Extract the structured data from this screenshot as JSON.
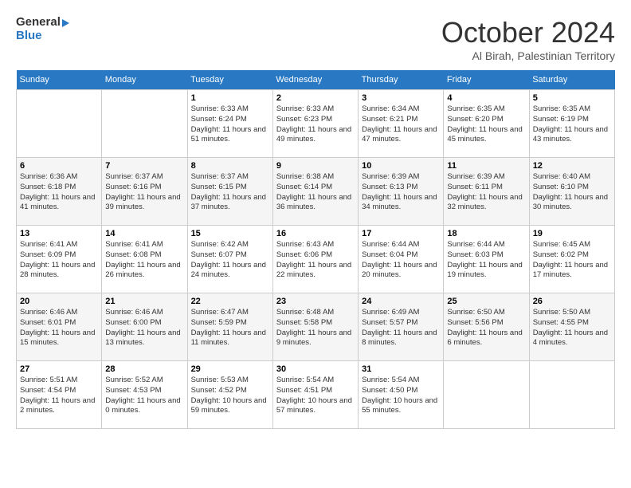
{
  "header": {
    "logo": {
      "general": "General",
      "blue": "Blue"
    },
    "title": "October 2024",
    "location": "Al Birah, Palestinian Territory"
  },
  "days": [
    "Sunday",
    "Monday",
    "Tuesday",
    "Wednesday",
    "Thursday",
    "Friday",
    "Saturday"
  ],
  "weeks": [
    [
      {
        "num": "",
        "text": ""
      },
      {
        "num": "",
        "text": ""
      },
      {
        "num": "1",
        "text": "Sunrise: 6:33 AM\nSunset: 6:24 PM\nDaylight: 11 hours and 51 minutes."
      },
      {
        "num": "2",
        "text": "Sunrise: 6:33 AM\nSunset: 6:23 PM\nDaylight: 11 hours and 49 minutes."
      },
      {
        "num": "3",
        "text": "Sunrise: 6:34 AM\nSunset: 6:21 PM\nDaylight: 11 hours and 47 minutes."
      },
      {
        "num": "4",
        "text": "Sunrise: 6:35 AM\nSunset: 6:20 PM\nDaylight: 11 hours and 45 minutes."
      },
      {
        "num": "5",
        "text": "Sunrise: 6:35 AM\nSunset: 6:19 PM\nDaylight: 11 hours and 43 minutes."
      }
    ],
    [
      {
        "num": "6",
        "text": "Sunrise: 6:36 AM\nSunset: 6:18 PM\nDaylight: 11 hours and 41 minutes."
      },
      {
        "num": "7",
        "text": "Sunrise: 6:37 AM\nSunset: 6:16 PM\nDaylight: 11 hours and 39 minutes."
      },
      {
        "num": "8",
        "text": "Sunrise: 6:37 AM\nSunset: 6:15 PM\nDaylight: 11 hours and 37 minutes."
      },
      {
        "num": "9",
        "text": "Sunrise: 6:38 AM\nSunset: 6:14 PM\nDaylight: 11 hours and 36 minutes."
      },
      {
        "num": "10",
        "text": "Sunrise: 6:39 AM\nSunset: 6:13 PM\nDaylight: 11 hours and 34 minutes."
      },
      {
        "num": "11",
        "text": "Sunrise: 6:39 AM\nSunset: 6:11 PM\nDaylight: 11 hours and 32 minutes."
      },
      {
        "num": "12",
        "text": "Sunrise: 6:40 AM\nSunset: 6:10 PM\nDaylight: 11 hours and 30 minutes."
      }
    ],
    [
      {
        "num": "13",
        "text": "Sunrise: 6:41 AM\nSunset: 6:09 PM\nDaylight: 11 hours and 28 minutes."
      },
      {
        "num": "14",
        "text": "Sunrise: 6:41 AM\nSunset: 6:08 PM\nDaylight: 11 hours and 26 minutes."
      },
      {
        "num": "15",
        "text": "Sunrise: 6:42 AM\nSunset: 6:07 PM\nDaylight: 11 hours and 24 minutes."
      },
      {
        "num": "16",
        "text": "Sunrise: 6:43 AM\nSunset: 6:06 PM\nDaylight: 11 hours and 22 minutes."
      },
      {
        "num": "17",
        "text": "Sunrise: 6:44 AM\nSunset: 6:04 PM\nDaylight: 11 hours and 20 minutes."
      },
      {
        "num": "18",
        "text": "Sunrise: 6:44 AM\nSunset: 6:03 PM\nDaylight: 11 hours and 19 minutes."
      },
      {
        "num": "19",
        "text": "Sunrise: 6:45 AM\nSunset: 6:02 PM\nDaylight: 11 hours and 17 minutes."
      }
    ],
    [
      {
        "num": "20",
        "text": "Sunrise: 6:46 AM\nSunset: 6:01 PM\nDaylight: 11 hours and 15 minutes."
      },
      {
        "num": "21",
        "text": "Sunrise: 6:46 AM\nSunset: 6:00 PM\nDaylight: 11 hours and 13 minutes."
      },
      {
        "num": "22",
        "text": "Sunrise: 6:47 AM\nSunset: 5:59 PM\nDaylight: 11 hours and 11 minutes."
      },
      {
        "num": "23",
        "text": "Sunrise: 6:48 AM\nSunset: 5:58 PM\nDaylight: 11 hours and 9 minutes."
      },
      {
        "num": "24",
        "text": "Sunrise: 6:49 AM\nSunset: 5:57 PM\nDaylight: 11 hours and 8 minutes."
      },
      {
        "num": "25",
        "text": "Sunrise: 6:50 AM\nSunset: 5:56 PM\nDaylight: 11 hours and 6 minutes."
      },
      {
        "num": "26",
        "text": "Sunrise: 5:50 AM\nSunset: 4:55 PM\nDaylight: 11 hours and 4 minutes."
      }
    ],
    [
      {
        "num": "27",
        "text": "Sunrise: 5:51 AM\nSunset: 4:54 PM\nDaylight: 11 hours and 2 minutes."
      },
      {
        "num": "28",
        "text": "Sunrise: 5:52 AM\nSunset: 4:53 PM\nDaylight: 11 hours and 0 minutes."
      },
      {
        "num": "29",
        "text": "Sunrise: 5:53 AM\nSunset: 4:52 PM\nDaylight: 10 hours and 59 minutes."
      },
      {
        "num": "30",
        "text": "Sunrise: 5:54 AM\nSunset: 4:51 PM\nDaylight: 10 hours and 57 minutes."
      },
      {
        "num": "31",
        "text": "Sunrise: 5:54 AM\nSunset: 4:50 PM\nDaylight: 10 hours and 55 minutes."
      },
      {
        "num": "",
        "text": ""
      },
      {
        "num": "",
        "text": ""
      }
    ]
  ]
}
